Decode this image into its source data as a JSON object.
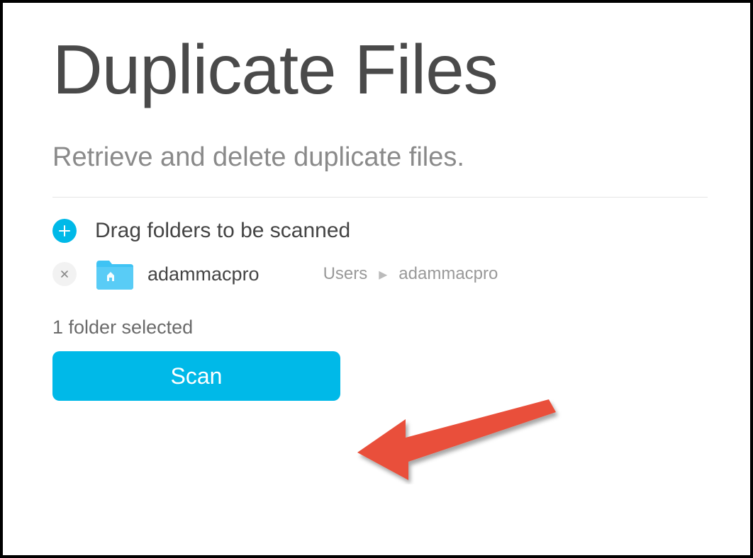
{
  "title": "Duplicate Files",
  "subtitle": "Retrieve and delete duplicate files.",
  "drag_label": "Drag folders to be scanned",
  "folder": {
    "name": "adammacpro",
    "path": [
      "Users",
      "adammacpro"
    ]
  },
  "status": "1 folder selected",
  "scan_label": "Scan",
  "colors": {
    "accent": "#00b9e8",
    "arrow": "#e94f3a"
  }
}
